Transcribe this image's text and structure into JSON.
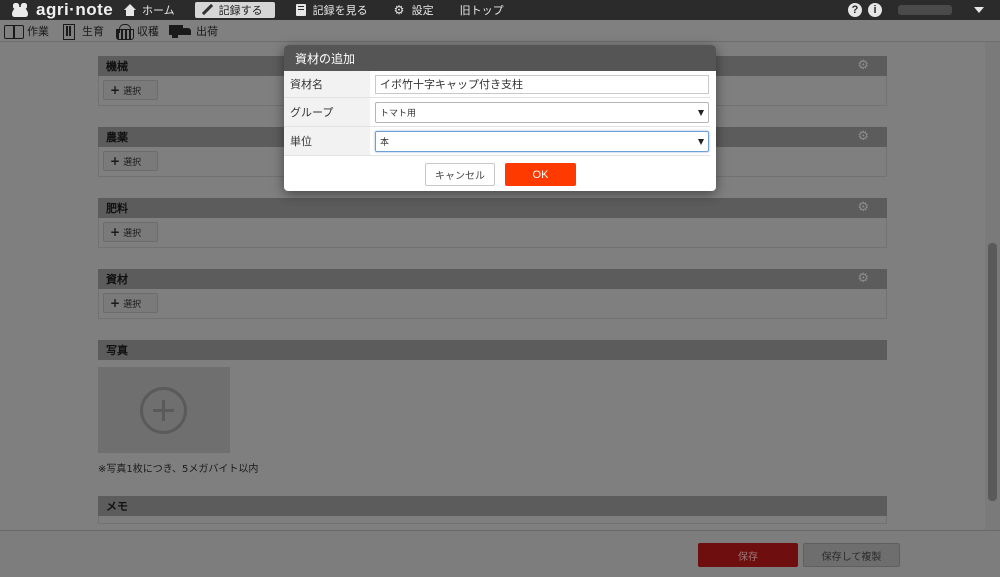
{
  "app": {
    "logo_text": "agri·note"
  },
  "nav": {
    "items": [
      {
        "label": "ホーム",
        "icon": "home-icon"
      },
      {
        "label": "記録する",
        "icon": "pencil-icon",
        "active": true
      },
      {
        "label": "記録を見る",
        "icon": "book-icon"
      },
      {
        "label": "設定",
        "icon": "gear-icon"
      },
      {
        "label": "旧トップ"
      }
    ],
    "help_glyph": "?",
    "info_glyph": "i"
  },
  "subnav": {
    "items": [
      {
        "label": "作業",
        "icon": "book-open-icon"
      },
      {
        "label": "生育",
        "icon": "ruler-icon"
      },
      {
        "label": "収穫",
        "icon": "basket-icon"
      },
      {
        "label": "出荷",
        "icon": "truck-icon"
      }
    ]
  },
  "sections": {
    "machinery": {
      "title": "機械",
      "button_label": "選択"
    },
    "pesticide": {
      "title": "農薬",
      "button_label": "選択"
    },
    "fertilizer": {
      "title": "肥料",
      "button_label": "選択"
    },
    "materials": {
      "title": "資材",
      "button_label": "選択"
    },
    "photos": {
      "title": "写真",
      "note": "※写真1枚につき、5メガバイト以内"
    },
    "memo": {
      "title": "メモ"
    }
  },
  "footer": {
    "save_label": "保存",
    "save_copy_label": "保存して複製"
  },
  "modal": {
    "title": "資材の追加",
    "fields": {
      "name": {
        "label": "資材名",
        "value": "イボ竹十字キャップ付き支柱"
      },
      "group": {
        "label": "グループ",
        "value": "トマト用"
      },
      "unit": {
        "label": "単位",
        "value": "本"
      }
    },
    "cancel_label": "キャンセル",
    "ok_label": "OK"
  },
  "colors": {
    "accent": "#ff3a00",
    "modal_header": "#555555",
    "topbar": "#2b2b2b"
  }
}
